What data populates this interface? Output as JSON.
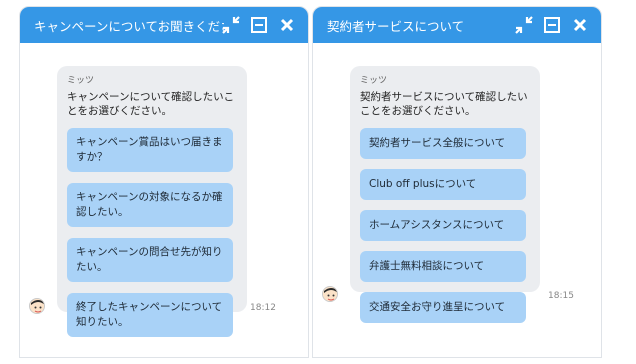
{
  "left_panel": {
    "title": "キャンペーンについてお聞きくださ",
    "sender": "ミッツ",
    "message": "キャンペーンについて確認したいことをお選びください。",
    "options": [
      "キャンペーン賞品はいつ届きますか？",
      "キャンペーンの対象になるか確認したい。",
      "キャンペーンの問合せ先が知りたい。",
      "終了したキャンペーンについて知りたい。"
    ],
    "timestamp": "18:12"
  },
  "right_panel": {
    "title": "契約者サービスについて",
    "sender": "ミッツ",
    "message": "契約者サービスについて確認したいことをお選びください。",
    "options": [
      "契約者サービス全般について",
      "Club off plusについて",
      "ホームアシスタンスについて",
      "弁護士無料相談について",
      "交通安全お守り進呈について"
    ],
    "timestamp": "18:15"
  },
  "icons": {
    "collapse": "collapse-arrows-icon",
    "minimize": "minimize-icon",
    "close": "close-icon",
    "avatar": "operator-avatar"
  },
  "colors": {
    "header": "#3597e6",
    "option": "#a9d2f7",
    "bubble": "#ebedf0"
  }
}
